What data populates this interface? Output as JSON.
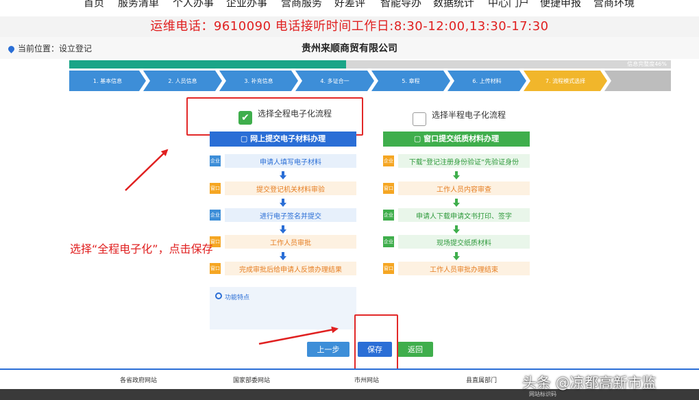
{
  "top_nav": [
    "首页",
    "服务清单",
    "个人办事",
    "企业办事",
    "营商服务",
    "好差评",
    "智能导办",
    "数据统计",
    "中心门户",
    "便捷申报",
    "营商环境"
  ],
  "hotline": "运维电话：9610090 电话接听时间工作日:8:30-12:00,13:30-17:30",
  "location": {
    "label": "当前位置：设立登记"
  },
  "company_name": "贵州来顺商贸有限公司",
  "progress": {
    "value": 0.46,
    "label": "信息完整度46%"
  },
  "steps": [
    {
      "label": "1. 基本信息",
      "state": "done"
    },
    {
      "label": "2. 人员信息",
      "state": "done"
    },
    {
      "label": "3. 补充信息",
      "state": "done"
    },
    {
      "label": "4. 多证合一",
      "state": "done"
    },
    {
      "label": "5. 章程",
      "state": "done"
    },
    {
      "label": "6. 上传材料",
      "state": "done"
    },
    {
      "label": "7. 流程模式选择",
      "state": "active"
    }
  ],
  "options": {
    "electronic": {
      "label": "选择全程电子化流程",
      "checked": true
    },
    "paper": {
      "label": "选择半程电子化流程",
      "checked": false
    }
  },
  "online_panel": {
    "title": "网上提交电子材料办理",
    "steps": [
      {
        "tag": "企业",
        "text": "申请人填写电子材料"
      },
      {
        "tag": "窗口",
        "text": "提交登记机关材料审验"
      },
      {
        "tag": "企业",
        "text": "进行电子签名并提交"
      },
      {
        "tag": "窗口",
        "text": "工作人员审批"
      },
      {
        "tag": "窗口",
        "text": "完成审批后给申请人反馈办理结果"
      }
    ],
    "features_label": "功能特点"
  },
  "window_panel": {
    "title": "窗口提交纸质材料办理",
    "steps": [
      {
        "tag": "企业",
        "text": "下载“登记注册身份验证”先验证身份"
      },
      {
        "tag": "窗口",
        "text": "工作人员内容审查"
      },
      {
        "tag": "企业",
        "text": "申请人下载申请文书打印、签字"
      },
      {
        "tag": "企业",
        "text": "现场提交纸质材料"
      },
      {
        "tag": "窗口",
        "text": "工作人员审批办理结束"
      }
    ]
  },
  "buttons": {
    "prev": "上一步",
    "save": "保存",
    "back": "返回"
  },
  "annotation": "选择“全程电子化”，点击保存",
  "footer_links": [
    "各省政府网站",
    "国家部委网站",
    "市州网站",
    "县直属部门"
  ],
  "bottom_bar_text": "网站标识码",
  "watermark": "头条 @凉都高新市监",
  "colors": {
    "accent_blue": "#2a6ed6",
    "step_blue": "#3d8ed8",
    "green": "#3fae4c",
    "teal_progress": "#1aa587",
    "active_step": "#f1b62b",
    "annotation_red": "#e02020"
  }
}
